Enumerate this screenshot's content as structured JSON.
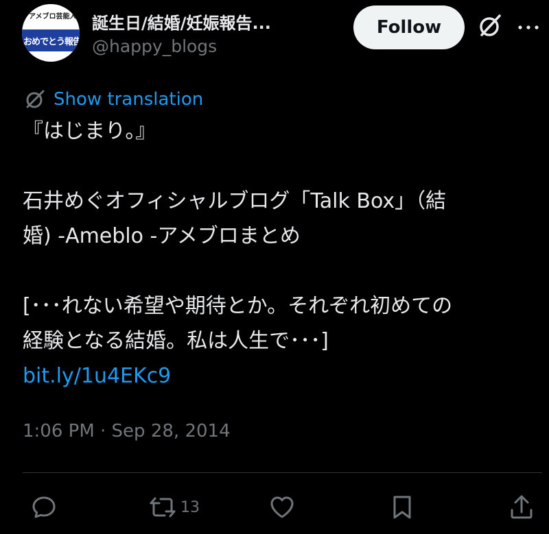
{
  "author": {
    "avatar_top_text": "アメブロ芸能人",
    "avatar_band_text": "おめでとう報告",
    "display_name": "誕生日/結婚/妊娠報告...",
    "handle": "@happy_blogs"
  },
  "follow_label": "Follow",
  "translation_label": "Show translation",
  "tweet": {
    "lines": [
      "『はじまり。』",
      "",
      " 石井めぐオフィシャルブログ「Talk Box」（結",
      "婚) -Ameblo -アメブロまとめ",
      "",
      "  [･･･れない希望や期待とか。それぞれ初めての",
      "経験となる結婚。私は人生で･･･]"
    ],
    "link": "bit.ly/1u4EKc9",
    "timestamp": "1:06 PM · Sep 28, 2014"
  },
  "actions": {
    "reply_icon": "reply-icon",
    "retweet_icon": "retweet-icon",
    "retweet_count": "13",
    "like_icon": "heart-icon",
    "bookmark_icon": "bookmark-icon",
    "share_icon": "share-icon"
  },
  "colors": {
    "background": "#000000",
    "text": "#e7e9ea",
    "muted": "#71767b",
    "link": "#1d9bf0",
    "follow_bg": "#eff3f4",
    "avatar_band": "#1f3f9e"
  }
}
